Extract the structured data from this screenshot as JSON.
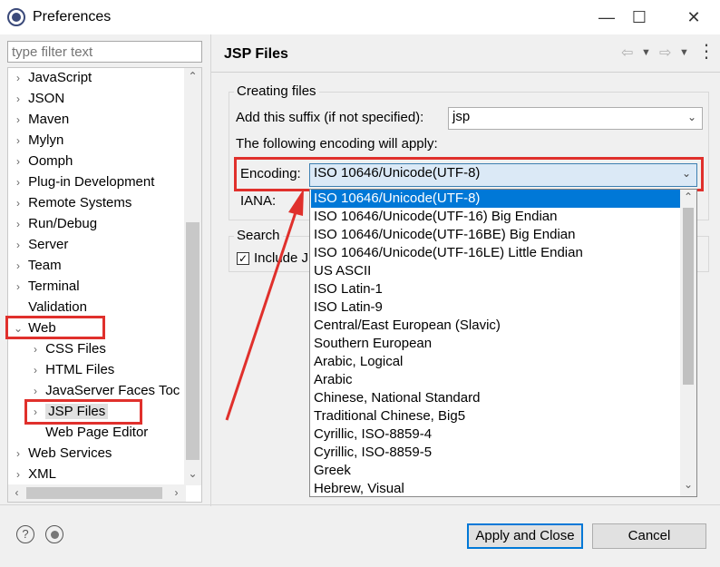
{
  "window": {
    "title": "Preferences",
    "minimize": "—",
    "maximize": "☐",
    "close": "✕"
  },
  "filter": {
    "placeholder": "type filter text"
  },
  "tree": {
    "items": [
      {
        "label": "JavaScript"
      },
      {
        "label": "JSON"
      },
      {
        "label": "Maven"
      },
      {
        "label": "Mylyn"
      },
      {
        "label": "Oomph"
      },
      {
        "label": "Plug-in Development"
      },
      {
        "label": "Remote Systems"
      },
      {
        "label": "Run/Debug"
      },
      {
        "label": "Server"
      },
      {
        "label": "Team"
      },
      {
        "label": "Terminal"
      },
      {
        "label": "Validation"
      },
      {
        "label": "Web"
      },
      {
        "label": "CSS Files"
      },
      {
        "label": "HTML Files"
      },
      {
        "label": "JavaServer Faces Toc"
      },
      {
        "label": "JSP Files"
      },
      {
        "label": "Web Page Editor"
      },
      {
        "label": "Web Services"
      },
      {
        "label": "XML"
      }
    ]
  },
  "page": {
    "title": "JSP Files",
    "creating_files": {
      "group_label": "Creating files",
      "suffix_label": "Add this suffix (if not specified):",
      "suffix_value": "jsp",
      "encoding_note": "The following encoding will apply:",
      "encoding_label": "Encoding:",
      "encoding_value": "ISO 10646/Unicode(UTF-8)",
      "iana_label": "IANA:"
    },
    "search": {
      "group_label": "Search",
      "include_label": "Include J"
    },
    "encoding_options": [
      "ISO 10646/Unicode(UTF-8)",
      "ISO 10646/Unicode(UTF-16) Big Endian",
      "ISO 10646/Unicode(UTF-16BE) Big Endian",
      "ISO 10646/Unicode(UTF-16LE) Little Endian",
      "US ASCII",
      "ISO Latin-1",
      "ISO Latin-9",
      "Central/East European (Slavic)",
      "Southern European",
      "Arabic, Logical",
      "Arabic",
      "Chinese, National Standard",
      "Traditional Chinese, Big5",
      "Cyrillic, ISO-8859-4",
      "Cyrillic, ISO-8859-5",
      "Greek",
      "Hebrew, Visual"
    ]
  },
  "footer": {
    "help_icon": "?",
    "apply_close": "Apply and Close",
    "cancel": "Cancel"
  },
  "colors": {
    "highlight": "#e0302c",
    "selection": "#0078d7"
  }
}
